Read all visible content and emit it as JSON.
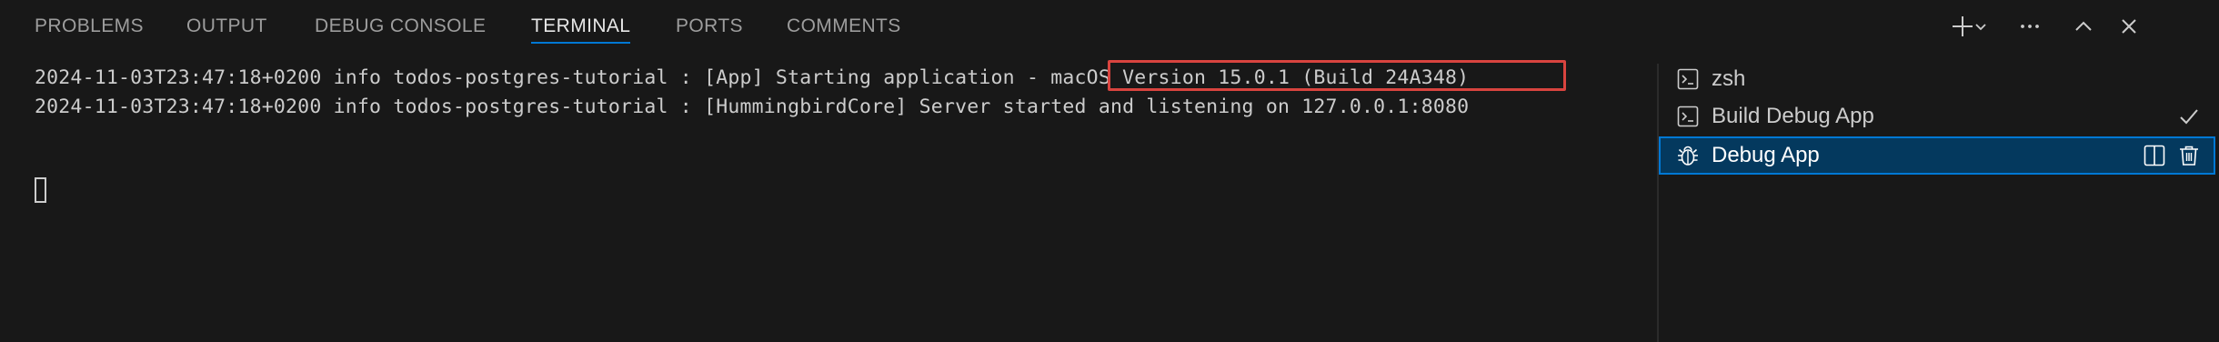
{
  "panel": {
    "tabs": [
      {
        "label": "PROBLEMS",
        "active": false
      },
      {
        "label": "OUTPUT",
        "active": false
      },
      {
        "label": "DEBUG CONSOLE",
        "active": false
      },
      {
        "label": "TERMINAL",
        "active": true
      },
      {
        "label": "PORTS",
        "active": false
      },
      {
        "label": "COMMENTS",
        "active": false
      }
    ],
    "actions": [
      {
        "icon": "plus-icon"
      },
      {
        "icon": "chevron-down-icon"
      },
      {
        "icon": "ellipsis-icon"
      },
      {
        "icon": "chevron-up-icon"
      },
      {
        "icon": "close-icon"
      }
    ]
  },
  "terminal": {
    "lines": [
      {
        "text": "2024-11-03T23:47:18+0200 info todos-postgres-tutorial : [App] Starting application - macOS Version 15.0.1 (Build 24A348)"
      },
      {
        "text": "2024-11-03T23:47:18+0200 info todos-postgres-tutorial : [HummingbirdCore] Server started and listening on 127.0.0.1:8080"
      }
    ],
    "highlighted_text": "macOS Version 15.0.1 (Build 24A348)",
    "highlight_color": "#d9443f"
  },
  "terminal_list": {
    "items": [
      {
        "label": "zsh",
        "icon": "terminal-icon",
        "selected": false
      },
      {
        "label": "Build Debug App",
        "icon": "terminal-icon",
        "selected": false,
        "status_icon": "check-icon"
      },
      {
        "label": "Debug App",
        "icon": "debug-bug-icon",
        "selected": true,
        "actions": [
          "split-icon",
          "trash-icon"
        ]
      }
    ]
  },
  "colors": {
    "background": "#181818",
    "active_tab_underline": "#0078d4",
    "selected_item_bg": "#04395e",
    "selected_item_border": "#0078d4"
  }
}
